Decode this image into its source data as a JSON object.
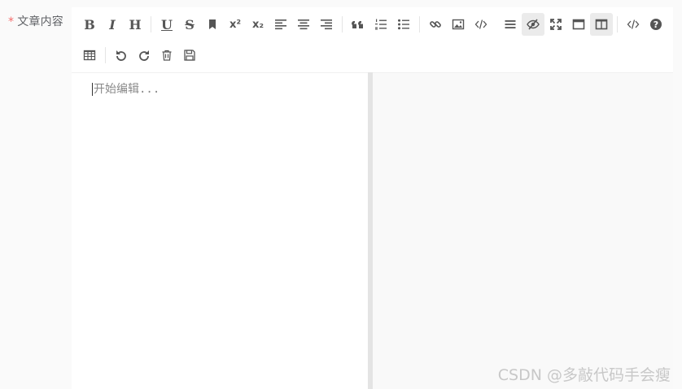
{
  "form": {
    "required_mark": "*",
    "label": "文章内容"
  },
  "toolbar": {
    "row1": [
      {
        "name": "bold-button",
        "glyph": "B",
        "icon": "bold-icon"
      },
      {
        "name": "italic-button",
        "glyph": "I",
        "icon": "italic-icon"
      },
      {
        "name": "header-button",
        "glyph": "H",
        "icon": "header-icon"
      },
      {
        "sep": true
      },
      {
        "name": "underline-button",
        "glyph": "U",
        "icon": "underline-icon"
      },
      {
        "name": "strikethrough-button",
        "glyph": "S",
        "icon": "strikethrough-icon"
      },
      {
        "name": "mark-button",
        "icon": "bookmark-icon"
      },
      {
        "name": "superscript-button",
        "glyph": "x²",
        "icon": "superscript-icon"
      },
      {
        "name": "subscript-button",
        "glyph": "x₂",
        "icon": "subscript-icon"
      },
      {
        "name": "align-left-button",
        "icon": "align-left-icon"
      },
      {
        "name": "align-center-button",
        "icon": "align-center-icon"
      },
      {
        "name": "align-right-button",
        "icon": "align-right-icon"
      },
      {
        "sep": true
      },
      {
        "name": "quote-button",
        "icon": "quote-icon"
      },
      {
        "name": "ordered-list-button",
        "icon": "ordered-list-icon"
      },
      {
        "name": "unordered-list-button",
        "icon": "unordered-list-icon"
      },
      {
        "sep": true
      },
      {
        "name": "link-button",
        "icon": "link-icon"
      },
      {
        "name": "image-button",
        "icon": "image-icon"
      },
      {
        "name": "code-button",
        "icon": "code-icon"
      },
      {
        "gap": true
      },
      {
        "name": "navigation-button",
        "icon": "menu-icon"
      },
      {
        "name": "preview-button",
        "icon": "eye-slash-icon",
        "active": true
      },
      {
        "name": "fullscreen-button",
        "icon": "expand-icon"
      },
      {
        "name": "read-mode-button",
        "icon": "window-icon"
      },
      {
        "name": "subfield-button",
        "icon": "columns-icon",
        "active": true
      },
      {
        "sep": true
      },
      {
        "name": "html-code-button",
        "icon": "code-icon"
      },
      {
        "name": "help-button",
        "icon": "help-icon"
      }
    ],
    "row2": [
      {
        "name": "table-button",
        "icon": "table-icon"
      },
      {
        "sep": true
      },
      {
        "name": "undo-button",
        "icon": "undo-icon"
      },
      {
        "name": "redo-button",
        "icon": "redo-icon"
      },
      {
        "name": "trash-button",
        "icon": "trash-icon"
      },
      {
        "name": "save-button",
        "icon": "save-icon"
      }
    ]
  },
  "editor": {
    "placeholder": "开始编辑..."
  },
  "watermark": "CSDN @多敲代码手会瘦"
}
